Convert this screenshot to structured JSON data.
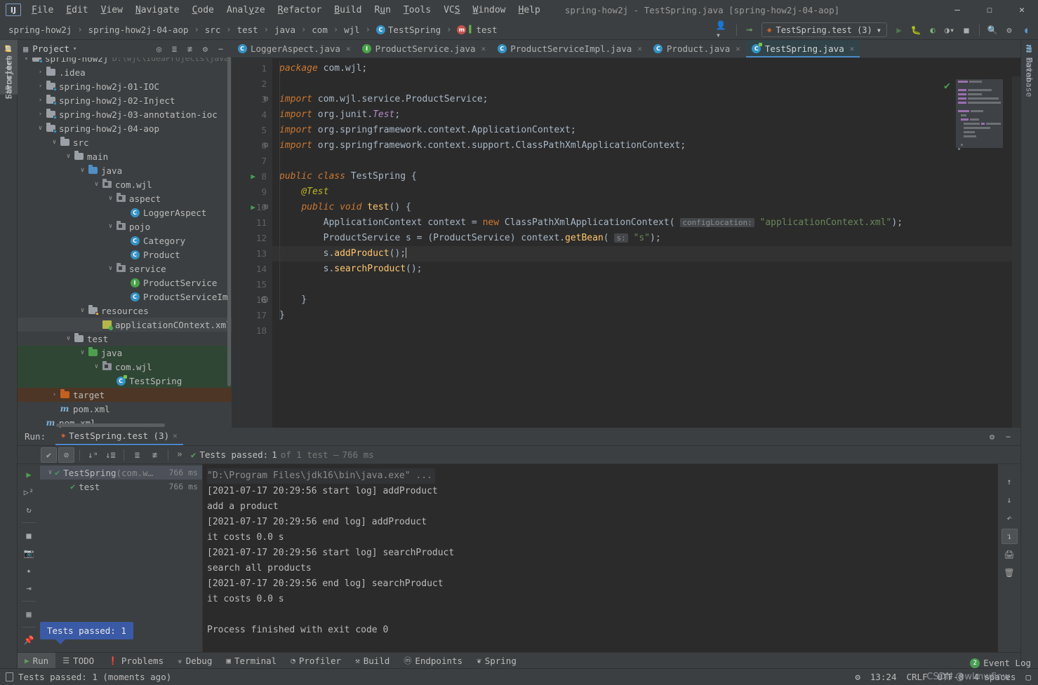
{
  "titlebar": {
    "logo": "IJ",
    "window_title": "spring-how2j - TestSpring.java [spring-how2j-04-aop]",
    "menus": [
      "File",
      "Edit",
      "View",
      "Navigate",
      "Code",
      "Analyze",
      "Refactor",
      "Build",
      "Run",
      "Tools",
      "VCS",
      "Window",
      "Help"
    ],
    "minimize": "–",
    "maximize": "☐",
    "close": "✕"
  },
  "navbar": {
    "crumbs": [
      "spring-how2j",
      "spring-how2j-04-aop",
      "src",
      "test",
      "java",
      "com",
      "wjl",
      "TestSpring",
      "test"
    ],
    "separator": "›",
    "run_config": "TestSpring.test (3)",
    "run_config_caret": "▾"
  },
  "left_tabs": [
    {
      "label": "Project",
      "active": true
    },
    {
      "label": "Structure",
      "active": false
    },
    {
      "label": "Favorites",
      "active": false
    }
  ],
  "right_tabs": [
    {
      "label": "Database"
    },
    {
      "label": "Maven"
    }
  ],
  "project": {
    "title": "Project",
    "caret": "▾",
    "tree": [
      {
        "indent": 0,
        "arrow": "∨",
        "icon": "module",
        "label": "spring-how2j",
        "path": "D:\\wjc\\IdeaProjects\\java",
        "partial": true
      },
      {
        "indent": 1,
        "arrow": "›",
        "icon": "folder",
        "label": ".idea"
      },
      {
        "indent": 1,
        "arrow": "›",
        "icon": "module",
        "label": "spring-how2j-01-IOC"
      },
      {
        "indent": 1,
        "arrow": "›",
        "icon": "module",
        "label": "spring-how2j-02-Inject"
      },
      {
        "indent": 1,
        "arrow": "›",
        "icon": "module",
        "label": "spring-how2j-03-annotation-ioc"
      },
      {
        "indent": 1,
        "arrow": "∨",
        "icon": "module",
        "label": "spring-how2j-04-aop"
      },
      {
        "indent": 2,
        "arrow": "∨",
        "icon": "folder",
        "label": "src"
      },
      {
        "indent": 3,
        "arrow": "∨",
        "icon": "folder",
        "label": "main"
      },
      {
        "indent": 4,
        "arrow": "∨",
        "icon": "folder-blue",
        "label": "java"
      },
      {
        "indent": 5,
        "arrow": "∨",
        "icon": "package",
        "label": "com.wjl"
      },
      {
        "indent": 6,
        "arrow": "∨",
        "icon": "package",
        "label": "aspect"
      },
      {
        "indent": 7,
        "arrow": "",
        "icon": "class",
        "label": "LoggerAspect"
      },
      {
        "indent": 6,
        "arrow": "∨",
        "icon": "package",
        "label": "pojo"
      },
      {
        "indent": 7,
        "arrow": "",
        "icon": "class",
        "label": "Category"
      },
      {
        "indent": 7,
        "arrow": "",
        "icon": "class",
        "label": "Product"
      },
      {
        "indent": 6,
        "arrow": "∨",
        "icon": "package",
        "label": "service"
      },
      {
        "indent": 7,
        "arrow": "",
        "icon": "interface",
        "label": "ProductService"
      },
      {
        "indent": 7,
        "arrow": "",
        "icon": "class",
        "label": "ProductServiceImpl"
      },
      {
        "indent": 4,
        "arrow": "∨",
        "icon": "folder-res",
        "label": "resources"
      },
      {
        "indent": 5,
        "arrow": "",
        "icon": "xml",
        "label": "applicationCOntext.xml",
        "selected": "dark"
      },
      {
        "indent": 3,
        "arrow": "∨",
        "icon": "folder",
        "label": "test"
      },
      {
        "indent": 4,
        "arrow": "∨",
        "icon": "folder-green",
        "label": "java",
        "selected": "green"
      },
      {
        "indent": 5,
        "arrow": "∨",
        "icon": "package",
        "label": "com.wjl",
        "selected": "green"
      },
      {
        "indent": 6,
        "arrow": "",
        "icon": "class-test",
        "label": "TestSpring",
        "selected": "green"
      },
      {
        "indent": 2,
        "arrow": "›",
        "icon": "folder-orange",
        "label": "target",
        "selected": "brown"
      },
      {
        "indent": 2,
        "arrow": "",
        "icon": "maven",
        "label": "pom.xml"
      },
      {
        "indent": 1,
        "arrow": "",
        "icon": "maven",
        "label": "pom.xml"
      }
    ]
  },
  "editor": {
    "tabs": [
      {
        "label": "LoggerAspect.java",
        "icon": "class",
        "active": false
      },
      {
        "label": "ProductService.java",
        "icon": "interface",
        "active": false
      },
      {
        "label": "ProductServiceImpl.java",
        "icon": "class",
        "active": false
      },
      {
        "label": "Product.java",
        "icon": "class",
        "active": false
      },
      {
        "label": "TestSpring.java",
        "icon": "class-test",
        "active": true
      }
    ],
    "close_glyph": "✕",
    "lines": [
      {
        "n": 1,
        "tokens": [
          {
            "t": "package ",
            "c": "kwi"
          },
          {
            "t": "com.wjl;",
            "c": "pln"
          }
        ]
      },
      {
        "n": 2,
        "tokens": []
      },
      {
        "n": 3,
        "fold": "⊟",
        "tokens": [
          {
            "t": "import ",
            "c": "kwi"
          },
          {
            "t": "com.wjl.service.ProductService;",
            "c": "pln"
          }
        ]
      },
      {
        "n": 4,
        "tokens": [
          {
            "t": "import ",
            "c": "kwi"
          },
          {
            "t": "org.junit.",
            "c": "pln"
          },
          {
            "t": "Test",
            "c": "pur"
          },
          {
            "t": ";",
            "c": "pln"
          }
        ]
      },
      {
        "n": 5,
        "tokens": [
          {
            "t": "import ",
            "c": "kwi"
          },
          {
            "t": "org.springframework.context.ApplicationContext;",
            "c": "pln"
          }
        ]
      },
      {
        "n": 6,
        "fold": "⊟",
        "tokens": [
          {
            "t": "import ",
            "c": "kwi"
          },
          {
            "t": "org.springframework.context.support.ClassPathXmlApplicationContext;",
            "c": "pln"
          }
        ]
      },
      {
        "n": 7,
        "tokens": []
      },
      {
        "n": 8,
        "gutter": "run",
        "tokens": [
          {
            "t": "public class ",
            "c": "kwi"
          },
          {
            "t": "TestSpring {",
            "c": "pln"
          }
        ]
      },
      {
        "n": 9,
        "tokens": [
          {
            "t": "    ",
            "c": "pln"
          },
          {
            "t": "@Test",
            "c": "ann"
          }
        ]
      },
      {
        "n": 10,
        "gutter": "run",
        "fold": "⊟",
        "tokens": [
          {
            "t": "    ",
            "c": "pln"
          },
          {
            "t": "public void ",
            "c": "kwi"
          },
          {
            "t": "test",
            "c": "mth"
          },
          {
            "t": "() {",
            "c": "pln"
          }
        ]
      },
      {
        "n": 11,
        "tokens": [
          {
            "t": "        ApplicationContext context = ",
            "c": "pln"
          },
          {
            "t": "new ",
            "c": "kw"
          },
          {
            "t": "ClassPathXmlApplicationContext( ",
            "c": "pln"
          },
          {
            "t": "configLocation:",
            "c": "hint"
          },
          {
            "t": " ",
            "c": "pln"
          },
          {
            "t": "\"applicationContext.xml\"",
            "c": "str"
          },
          {
            "t": ");",
            "c": "pln"
          }
        ]
      },
      {
        "n": 12,
        "tokens": [
          {
            "t": "        ProductService s = (ProductService) context.",
            "c": "pln"
          },
          {
            "t": "getBean",
            "c": "mth"
          },
          {
            "t": "( ",
            "c": "pln"
          },
          {
            "t": "s:",
            "c": "hint"
          },
          {
            "t": " ",
            "c": "pln"
          },
          {
            "t": "\"s\"",
            "c": "str"
          },
          {
            "t": ");",
            "c": "pln"
          }
        ]
      },
      {
        "n": 13,
        "current": true,
        "tokens": [
          {
            "t": "        s.",
            "c": "pln"
          },
          {
            "t": "addProduct",
            "c": "mth"
          },
          {
            "t": "();",
            "c": "pln"
          }
        ]
      },
      {
        "n": 14,
        "tokens": [
          {
            "t": "        s.",
            "c": "pln"
          },
          {
            "t": "searchProduct",
            "c": "mth"
          },
          {
            "t": "();",
            "c": "pln"
          }
        ]
      },
      {
        "n": 15,
        "tokens": []
      },
      {
        "n": 16,
        "fold": "⨁",
        "tokens": [
          {
            "t": "    }",
            "c": "pln"
          }
        ]
      },
      {
        "n": 17,
        "tokens": [
          {
            "t": "}",
            "c": "pln"
          }
        ]
      },
      {
        "n": 18,
        "tokens": []
      }
    ]
  },
  "run_panel": {
    "label": "Run:",
    "tab": "TestSpring.test (3)",
    "close_glyph": "✕",
    "status": {
      "prefix": "Tests passed:",
      "count": "1",
      "of": "of 1 test –",
      "time": "766 ms"
    },
    "expand_glyph": "»",
    "tests": [
      {
        "indent": 0,
        "arrow": "∨",
        "label": "TestSpring",
        "sub": "(com.w…",
        "time": "766 ms",
        "selected": true
      },
      {
        "indent": 1,
        "arrow": "",
        "label": "test",
        "sub": "",
        "time": "766 ms",
        "selected": false
      }
    ],
    "console": [
      {
        "text": "\"D:\\Program Files\\jdk16\\bin\\java.exe\" ...",
        "style": "cmd"
      },
      {
        "text": "[2021-07-17 20:29:56 start log] addProduct",
        "style": "out"
      },
      {
        "text": "add a product",
        "style": "out"
      },
      {
        "text": "[2021-07-17 20:29:56 end log] addProduct",
        "style": "out"
      },
      {
        "text": "it costs 0.0 s",
        "style": "out"
      },
      {
        "text": "[2021-07-17 20:29:56 start log] searchProduct",
        "style": "out"
      },
      {
        "text": "search all products",
        "style": "out"
      },
      {
        "text": "[2021-07-17 20:29:56 end log] searchProduct",
        "style": "out"
      },
      {
        "text": "it costs 0.0 s",
        "style": "out"
      },
      {
        "text": "",
        "style": "out"
      },
      {
        "text": "Process finished with exit code 0",
        "style": "out"
      }
    ],
    "tooltip": "Tests passed: 1"
  },
  "bottom_tabs": [
    {
      "label": "Run",
      "icon": "play",
      "active": true
    },
    {
      "label": "TODO",
      "icon": "list",
      "active": false
    },
    {
      "label": "Problems",
      "icon": "warning",
      "active": false
    },
    {
      "label": "Debug",
      "icon": "bug",
      "active": false
    },
    {
      "label": "Terminal",
      "icon": "terminal",
      "active": false
    },
    {
      "label": "Profiler",
      "icon": "profiler",
      "active": false
    },
    {
      "label": "Build",
      "icon": "hammer",
      "active": false
    },
    {
      "label": "Endpoints",
      "icon": "endpoints",
      "active": false
    },
    {
      "label": "Spring",
      "icon": "leaf",
      "active": false
    }
  ],
  "statusbar": {
    "message": "Tests passed: 1 (moments ago)",
    "time": "13:24",
    "line_sep": "CRLF",
    "encoding": "UTF-8",
    "indent": "4 spaces",
    "event_log": "Event Log",
    "event_count": "2",
    "watermark": "CSDN @wlmwfinw"
  }
}
